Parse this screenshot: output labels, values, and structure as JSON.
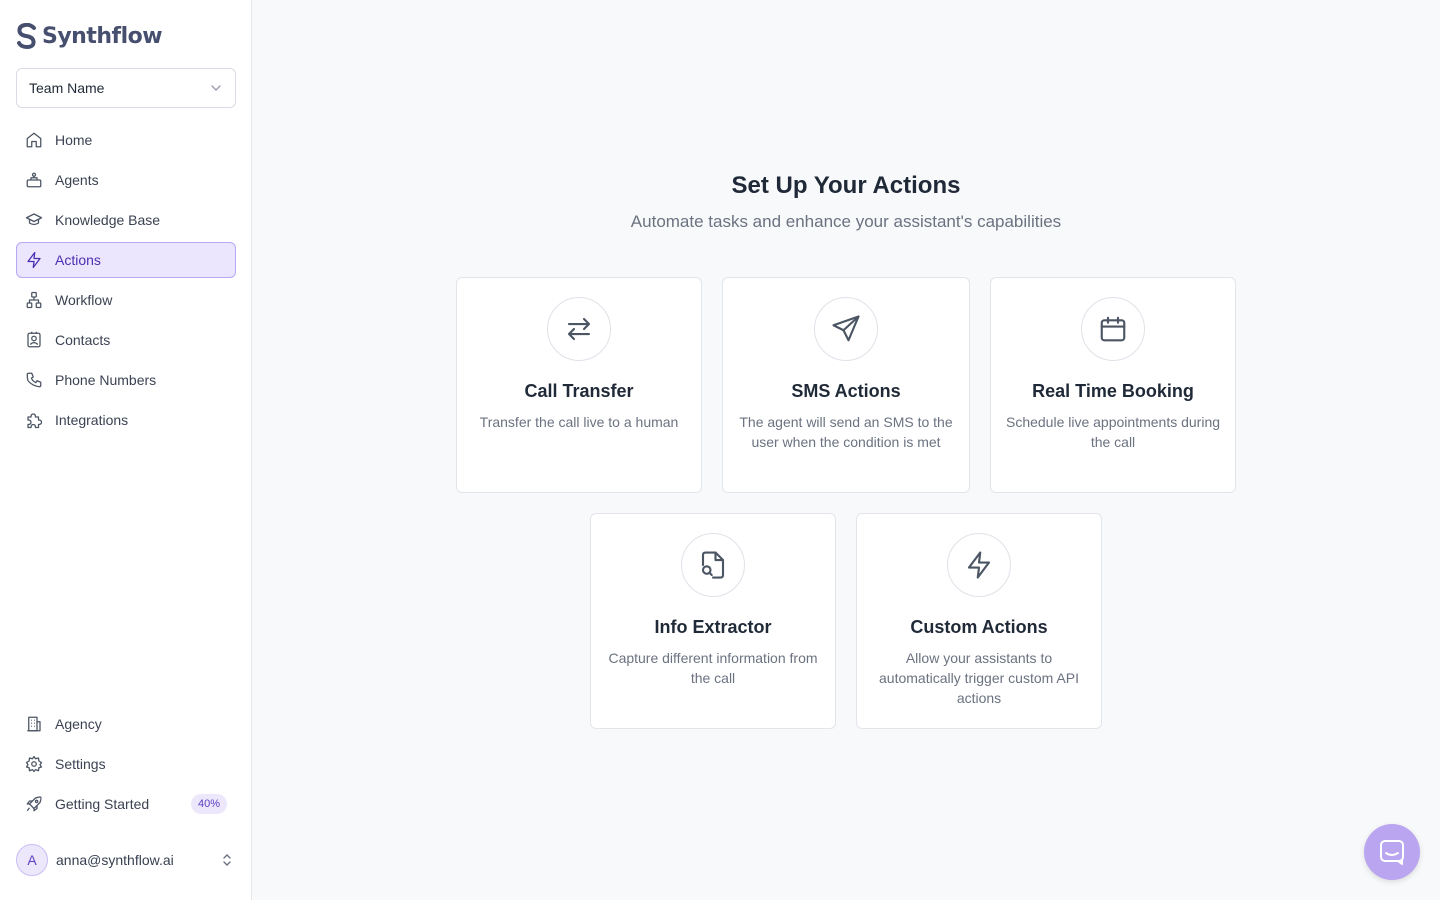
{
  "app": {
    "brand": "Synthflow"
  },
  "team_select": {
    "value": "Team Name"
  },
  "nav": [
    {
      "label": "Home",
      "icon": "home-icon"
    },
    {
      "label": "Agents",
      "icon": "robot-icon"
    },
    {
      "label": "Knowledge Base",
      "icon": "graduation-cap-icon"
    },
    {
      "label": "Actions",
      "icon": "lightning-icon",
      "active": true
    },
    {
      "label": "Workflow",
      "icon": "workflow-icon"
    },
    {
      "label": "Contacts",
      "icon": "contacts-icon"
    },
    {
      "label": "Phone Numbers",
      "icon": "phone-icon"
    },
    {
      "label": "Integrations",
      "icon": "puzzle-icon"
    }
  ],
  "nav_bottom": [
    {
      "label": "Agency",
      "icon": "building-icon"
    },
    {
      "label": "Settings",
      "icon": "gear-icon"
    },
    {
      "label": "Getting Started",
      "icon": "rocket-icon",
      "badge": "40%"
    }
  ],
  "user": {
    "avatar_initial": "A",
    "email": "anna@synthflow.ai"
  },
  "main": {
    "title": "Set Up Your Actions",
    "subtitle": "Automate tasks and enhance your assistant's capabilities",
    "cards": [
      {
        "title": "Call Transfer",
        "desc": "Transfer the call live to a human",
        "icon": "arrows-transfer-icon"
      },
      {
        "title": "SMS Actions",
        "desc": "The agent will send an SMS to the user when the condition is met",
        "icon": "send-icon"
      },
      {
        "title": "Real Time Booking",
        "desc": "Schedule live appointments during the call",
        "icon": "calendar-icon"
      },
      {
        "title": "Info Extractor",
        "desc": "Capture different information from the call",
        "icon": "file-search-icon"
      },
      {
        "title": "Custom Actions",
        "desc": "Allow your assistants to automatically trigger custom API actions",
        "icon": "lightning-icon"
      }
    ]
  },
  "colors": {
    "accent": "#5b3fc4",
    "active_bg": "#ebe6fd",
    "fab": "#b9a5f0"
  }
}
